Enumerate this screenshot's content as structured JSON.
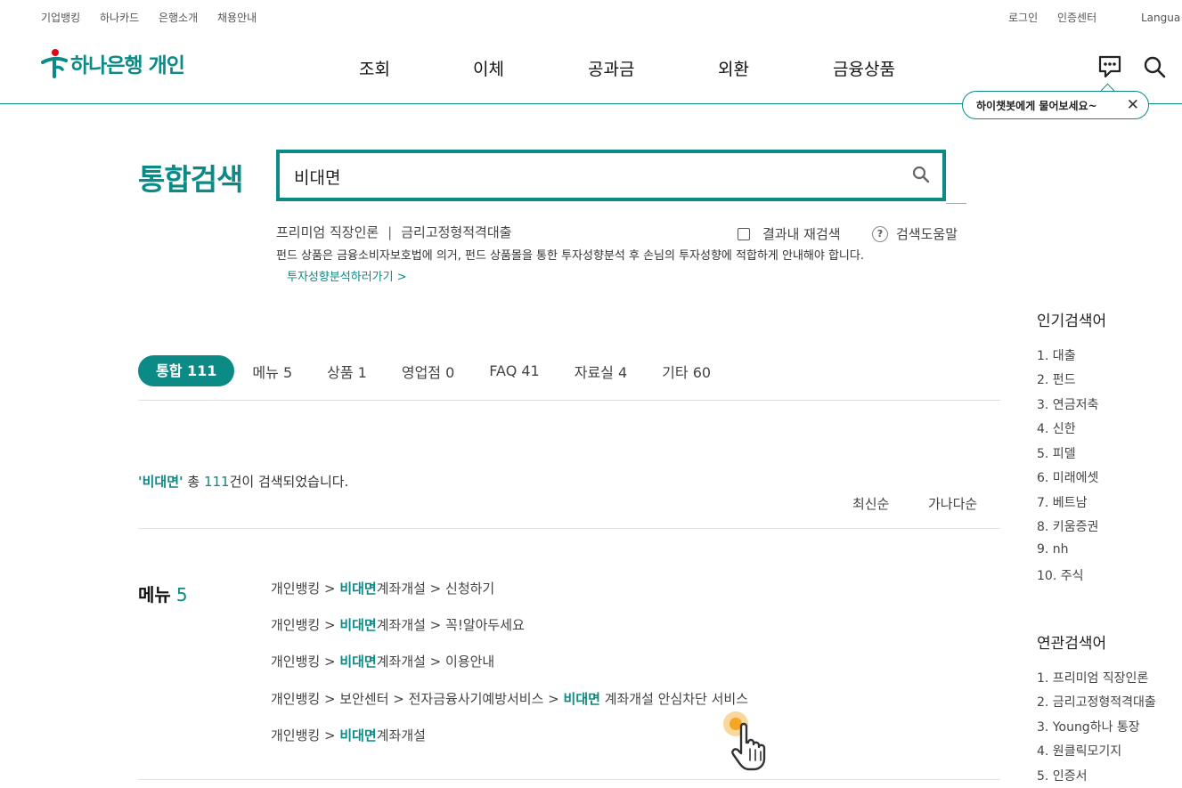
{
  "util_nav": {
    "left": [
      "기업뱅킹",
      "하나카드",
      "은행소개",
      "채용안내"
    ],
    "right": [
      "로그인",
      "인증센터",
      "Langua"
    ]
  },
  "logo": {
    "text": "하나은행 개인"
  },
  "gnb": [
    "조회",
    "이체",
    "공과금",
    "외환",
    "금융상품"
  ],
  "icons": {
    "chatbot": "chatbot-icon",
    "search": "search-icon"
  },
  "tooltip": {
    "text": "하이챗봇에게 물어보세요~",
    "close": "✕"
  },
  "search": {
    "title": "통합검색",
    "value": "비대면",
    "recommend": [
      "프리미엄 직장인론",
      "금리고정형적격대출"
    ],
    "recommend_sep": "|",
    "research_label": "결과내 재검색",
    "help_label": "검색도움말",
    "help_symbol": "?",
    "notice": "펀드 상품은 금융소비자보호법에 의거, 펀드 상품몰을 통한 투자성향분석 후 손님의 투자성향에 적합하게 안내해야 합니다.",
    "notice_link": "투자성향분석하러가기 >"
  },
  "tabs": [
    {
      "label": "통합 111",
      "active": true
    },
    {
      "label": "메뉴 5"
    },
    {
      "label": "상품 1"
    },
    {
      "label": "영업점 0"
    },
    {
      "label": "FAQ 41"
    },
    {
      "label": "자료실 4"
    },
    {
      "label": "기타 60"
    }
  ],
  "summary": {
    "keyword": "'비대면'",
    "pre": " 총 ",
    "count": "111",
    "post": "건이 검색되었습니다."
  },
  "sort": [
    "최신순",
    "가나다순"
  ],
  "menu_section": {
    "title": "메뉴",
    "count": "5",
    "results": [
      {
        "pre": "개인뱅킹 > ",
        "hl": "비대면",
        "post": "계좌개설 > 신청하기"
      },
      {
        "pre": "개인뱅킹 > ",
        "hl": "비대면",
        "post": "계좌개설 > 꼭!알아두세요"
      },
      {
        "pre": "개인뱅킹 > ",
        "hl": "비대면",
        "post": "계좌개설 > 이용안내"
      },
      {
        "pre": "개인뱅킹 > 보안센터 > 전자금융사기예방서비스 > ",
        "hl": "비대면",
        "post": " 계좌개설 안심차단 서비스"
      },
      {
        "pre": "개인뱅킹 > ",
        "hl": "비대면",
        "post": "계좌개설"
      }
    ]
  },
  "popular": {
    "title": "인기검색어",
    "items": [
      "1. 대출",
      "2. 펀드",
      "3. 연금저축",
      "4. 신한",
      "5. 피델",
      "6. 미래에셋",
      "7. 베트남",
      "8. 키움증권",
      "9. nh",
      "10. 주식"
    ]
  },
  "related": {
    "title": "연관검색어",
    "items": [
      "1. 프리미엄 직장인론",
      "2. 금리고정형적격대출",
      "3. Young하나 통장",
      "4. 원클릭모기지",
      "5. 인증서"
    ]
  },
  "colors": {
    "brand": "#0c8a86",
    "cursor": "#f5a623"
  }
}
